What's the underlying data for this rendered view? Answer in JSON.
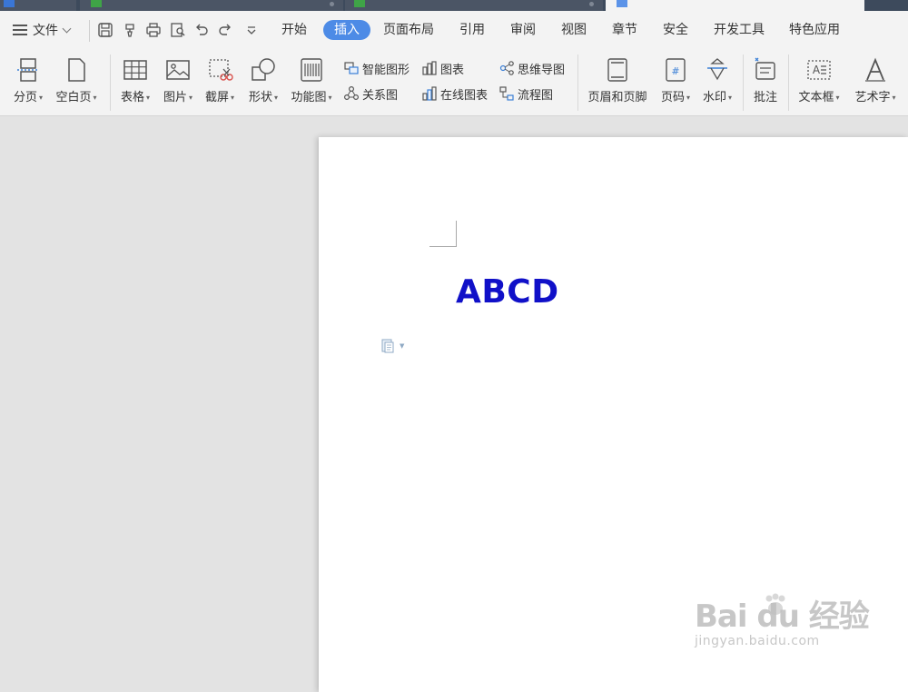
{
  "tabs": [
    {
      "name": "",
      "favicon": "#3a76d6"
    },
    {
      "name": "",
      "favicon": "#3fa447"
    },
    {
      "name": "",
      "favicon": "#3fa447"
    },
    {
      "name": "",
      "favicon": "#5b93e8"
    }
  ],
  "menubar": {
    "file_label": "文件",
    "tabs": [
      "开始",
      "插入",
      "页面布局",
      "引用",
      "审阅",
      "视图",
      "章节",
      "安全",
      "开发工具",
      "特色应用"
    ],
    "active_tab": "插入",
    "accent": "#4d8be6"
  },
  "ribbon": {
    "page_break": "分页",
    "blank_page": "空白页",
    "table": "表格",
    "picture": "图片",
    "screenshot": "截屏",
    "shapes": "形状",
    "function_chart": "功能图",
    "smart_art": "智能图形",
    "chart": "图表",
    "mind_map": "思维导图",
    "relation_chart": "关系图",
    "online_chart": "在线图表",
    "flowchart": "流程图",
    "header_footer": "页眉和页脚",
    "page_number": "页码",
    "watermark": "水印",
    "comment": "批注",
    "text_box": "文本框",
    "word_art": "艺术字"
  },
  "document": {
    "text": "ABCD",
    "text_color": "#1010c8"
  },
  "watermark": {
    "logo": "Bai du 经验",
    "url": "jingyan.baidu.com"
  }
}
